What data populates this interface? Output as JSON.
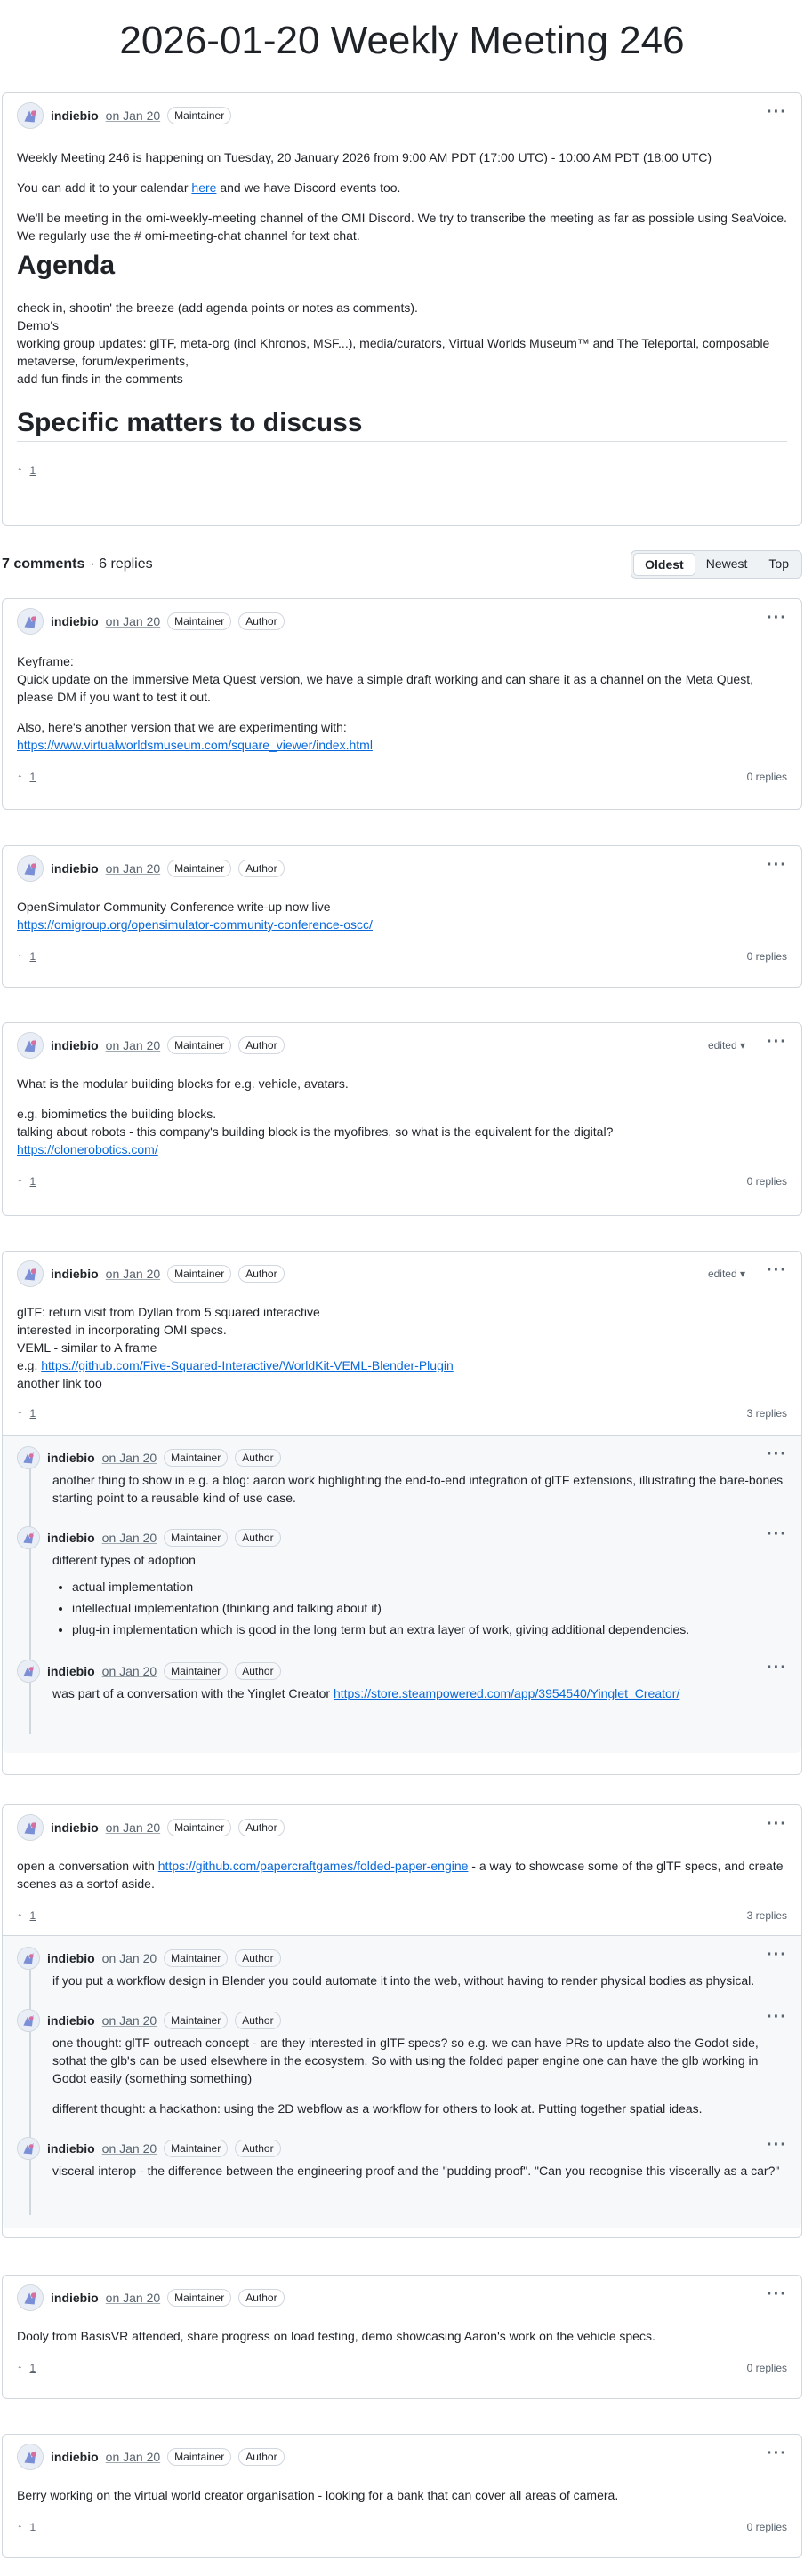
{
  "page": {
    "title": "2026-01-20 Weekly Meeting 246"
  },
  "colors": {
    "link": "#0969da",
    "muted": "#59636e",
    "border": "#d0d7de",
    "reply_bg": "#f6f8fa"
  },
  "post": {
    "author": "indiebio",
    "date": "on Jan 20",
    "badge_maintainer": "Maintainer",
    "paragraph1": "Weekly Meeting 246 is happening on Tuesday, 20 January 2026 from 9:00 AM PDT (17:00 UTC) - 10:00 AM PDT (18:00 UTC)",
    "calendar_before": "You can add it to your calendar ",
    "calendar_link": "here",
    "calendar_after": " and we have Discord events too.",
    "paragraph3": "We'll be meeting in the omi-weekly-meeting channel of the OMI Discord. We try to transcribe the meeting as far as possible using SeaVoice. We regularly use the # omi-meeting-chat channel for text chat.",
    "agenda_heading": "Agenda",
    "agenda_lines": [
      "check in, shootin' the breeze (add agenda points or notes as comments).",
      "Demo's",
      "working group updates: glTF, meta-org (incl Khronos, MSF...), media/curators, Virtual Worlds Museum™ and The Teleportal, composable metaverse, forum/experiments,",
      "add fun finds in the comments"
    ],
    "matters_heading": "Specific matters to discuss",
    "upvotes": "1"
  },
  "comments_bar": {
    "count": "7 comments",
    "replies": "· 6 replies",
    "sort_oldest": "Oldest",
    "sort_newest": "Newest",
    "sort_top": "Top"
  },
  "labels": {
    "author": "indiebio",
    "date": "on Jan 20",
    "maintainer": "Maintainer",
    "author_badge": "Author",
    "edited": "edited",
    "menu": "···",
    "upvote_arrow": "↑"
  },
  "comments": [
    {
      "lines": [
        "Keyframe:",
        "Quick update on the immersive Meta Quest version, we have a simple draft working and can share it as a channel on the Meta Quest, please DM if you want to test it out."
      ],
      "lines2": [
        "Also, here's another version that we are experimenting with:"
      ],
      "link": "https://www.virtualworldsmuseum.com/square_viewer/index.html",
      "upvotes": "1",
      "replies": "0 replies"
    },
    {
      "lines": [
        "OpenSimulator Community Conference write-up now live"
      ],
      "link": "https://omigroup.org/opensimulator-community-conference-oscc/",
      "upvotes": "1",
      "replies": "0 replies"
    },
    {
      "lines": [
        "What is the modular building blocks for e.g. vehicle, avatars."
      ],
      "lines2": [
        "e.g. biomimetics the building blocks.",
        "talking about robots - this company's building block is the myofibres, so what is the equivalent for the digital?"
      ],
      "link": "https://clonerobotics.com/",
      "upvotes": "1",
      "replies": "0 replies"
    },
    {
      "lines": [
        "glTF: return visit from Dyllan from 5 squared interactive",
        "interested in incorporating OMI specs.",
        "VEML - similar to A frame"
      ],
      "link_prefix": "e.g. ",
      "link": "https://github.com/Five-Squared-Interactive/WorldKit-VEML-Blender-Plugin",
      "after": "another link too",
      "upvotes": "1",
      "replies": "3 replies",
      "reply_items": [
        {
          "text": "another thing to show in e.g. a blog: aaron work highlighting the end-to-end integration of glTF extensions, illustrating the bare-bones starting point to a reusable kind of use case."
        },
        {
          "text": "different types of adoption",
          "bullets": [
            "actual implementation",
            "intellectual implementation (thinking and talking about it)",
            "plug-in implementation which is good in the long term but an extra layer of work, giving additional dependencies."
          ]
        },
        {
          "text": "was part of a conversation with the Yinglet Creator ",
          "link": "https://store.steampowered.com/app/3954540/Yinglet_Creator/"
        }
      ]
    },
    {
      "before": "open a conversation with ",
      "link": "https://github.com/papercraftgames/folded-paper-engine",
      "after": " - a way to showcase some of the glTF specs, and create scenes as a sortof aside.",
      "upvotes": "1",
      "replies": "3 replies",
      "reply_items": [
        {
          "text": "if you put a workflow design in Blender you could automate it into the web, without having to render physical bodies as physical."
        },
        {
          "text": "one thought: glTF outreach concept - are they interested in glTF specs? so e.g. we can have PRs to update also the Godot side, sothat the glb's can be used elsewhere in the ecosystem. So with using the folded paper engine one can have the glb working in Godot easily (something something)",
          "text2": "different thought: a hackathon: using the 2D webflow as a workflow for others to look at. Putting together spatial ideas."
        },
        {
          "text": "visceral interop - the difference between the engineering proof and the \"pudding proof\". \"Can you recognise this viscerally as a car?\""
        }
      ]
    },
    {
      "lines": [
        "Dooly from BasisVR attended, share progress on load testing, demo showcasing Aaron's work on the vehicle specs."
      ],
      "upvotes": "1",
      "replies": "0 replies"
    },
    {
      "lines": [
        "Berry working on the virtual world creator organisation - looking for a bank that can cover all areas of camera."
      ],
      "upvotes": "1",
      "replies": "0 replies"
    }
  ]
}
